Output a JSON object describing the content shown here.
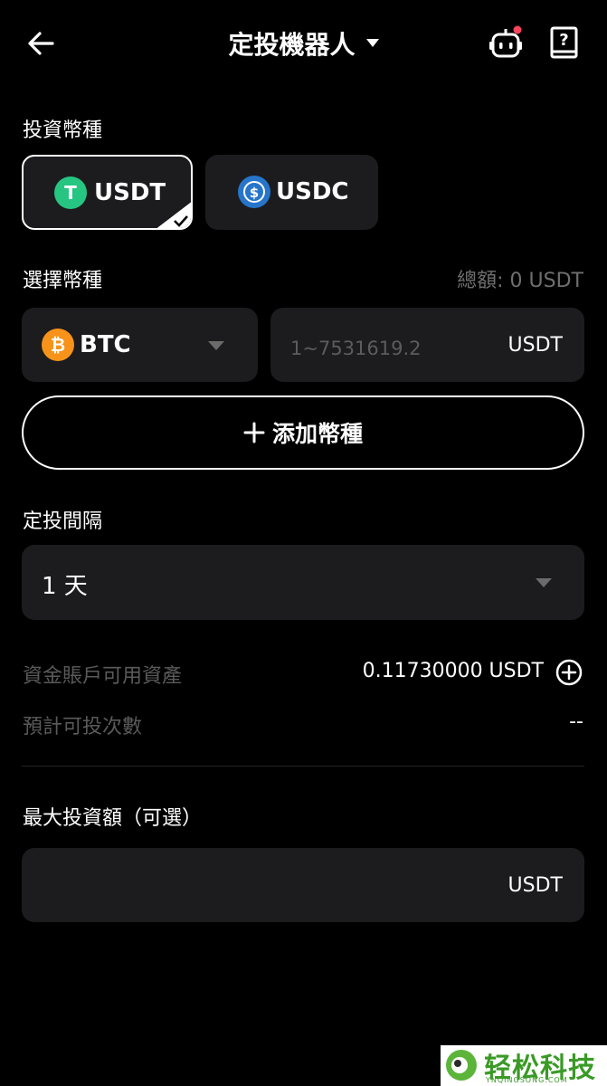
{
  "header": {
    "title": "定投機器人"
  },
  "invest_currency": {
    "label": "投資幣種",
    "options": [
      {
        "name": "USDT",
        "selected": true,
        "icon": "tether-icon",
        "color": "#26c682"
      },
      {
        "name": "USDC",
        "selected": false,
        "icon": "usdc-icon",
        "color": "#2775ca"
      }
    ]
  },
  "select_coin": {
    "label": "選擇幣種",
    "total": "總額: 0 USDT",
    "coin": "BTC",
    "coin_color": "#f7931a",
    "amount_placeholder": "1~7531619.2",
    "amount_unit": "USDT",
    "add_label": "添加幣種"
  },
  "interval": {
    "label": "定投間隔",
    "value": "1 天"
  },
  "account": {
    "available_label": "資金賬戶可用資產",
    "available_value": "0.11730000 USDT",
    "estimated_label": "預計可投次數",
    "estimated_value": "--"
  },
  "max_invest": {
    "label": "最大投資額（可選）",
    "unit": "USDT"
  },
  "watermark": {
    "text": "轻松科技",
    "sub": "YNQINGSONG.COM"
  }
}
